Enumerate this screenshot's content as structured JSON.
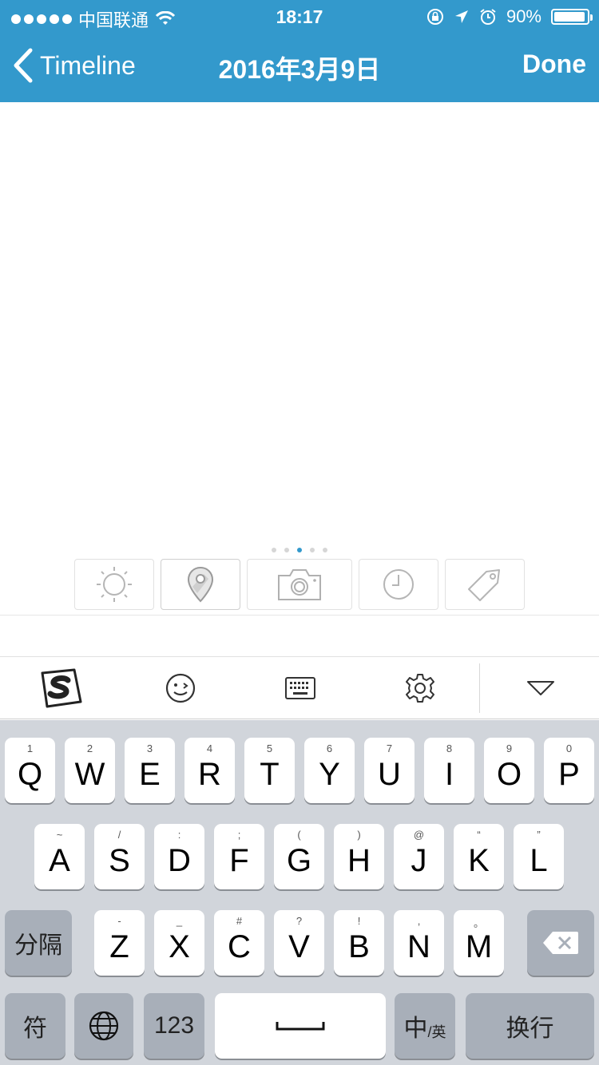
{
  "status_bar": {
    "carrier": "中国联通",
    "time": "18:17",
    "battery_percent": "90%"
  },
  "nav": {
    "back_label": "Timeline",
    "title": "2016年3月9日",
    "done_label": "Done"
  },
  "editor": {
    "text": ""
  },
  "pager": {
    "count": 5,
    "active_index": 2
  },
  "toolbar": {
    "items": [
      {
        "icon": "sun-icon",
        "selected": false
      },
      {
        "icon": "location-pin-icon",
        "selected": true
      },
      {
        "icon": "camera-icon",
        "selected": false
      },
      {
        "icon": "clock-icon",
        "selected": false
      },
      {
        "icon": "tag-icon",
        "selected": false
      }
    ]
  },
  "ime_bar": {
    "items": [
      "sogou-logo-icon",
      "emoji-icon",
      "keyboard-icon",
      "gear-icon",
      "chevron-down-icon"
    ]
  },
  "keyboard": {
    "row1": [
      {
        "k": "Q",
        "h": "1"
      },
      {
        "k": "W",
        "h": "2"
      },
      {
        "k": "E",
        "h": "3"
      },
      {
        "k": "R",
        "h": "4"
      },
      {
        "k": "T",
        "h": "5"
      },
      {
        "k": "Y",
        "h": "6"
      },
      {
        "k": "U",
        "h": "7"
      },
      {
        "k": "I",
        "h": "8"
      },
      {
        "k": "O",
        "h": "9"
      },
      {
        "k": "P",
        "h": "0"
      }
    ],
    "row2": [
      {
        "k": "A",
        "h": "~"
      },
      {
        "k": "S",
        "h": "/"
      },
      {
        "k": "D",
        "h": ":"
      },
      {
        "k": "F",
        "h": ";"
      },
      {
        "k": "G",
        "h": "("
      },
      {
        "k": "H",
        "h": ")"
      },
      {
        "k": "J",
        "h": "@"
      },
      {
        "k": "K",
        "h": "“"
      },
      {
        "k": "L",
        "h": "”"
      }
    ],
    "row3": [
      {
        "k": "Z",
        "h": "-"
      },
      {
        "k": "X",
        "h": "_"
      },
      {
        "k": "C",
        "h": "#"
      },
      {
        "k": "V",
        "h": "?"
      },
      {
        "k": "B",
        "h": "!"
      },
      {
        "k": "N",
        "h": ","
      },
      {
        "k": "M",
        "h": "。"
      }
    ],
    "separator_label": "分隔",
    "symbol_label": "符",
    "numbers_label": "123",
    "lang_main": "中",
    "lang_sub": "/英",
    "return_label": "换行"
  }
}
